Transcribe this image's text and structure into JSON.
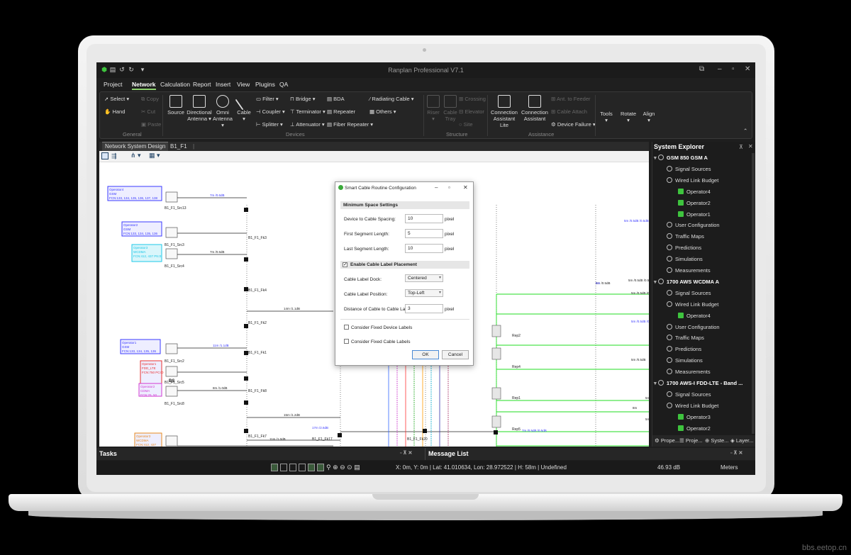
{
  "app": {
    "title": "Ranplan Professional V7.1",
    "quick_access": [
      "save-icon",
      "undo-icon",
      "redo-icon",
      "customize-icon"
    ]
  },
  "menu": [
    "Project",
    "Network",
    "Calculation",
    "Report",
    "Insert",
    "View",
    "Plugins",
    "QA"
  ],
  "menu_active": "Network",
  "ribbon": {
    "general": {
      "label": "General",
      "select": "Select",
      "hand": "Hand",
      "copy": "Copy",
      "cut": "Cut",
      "paste": "Paste"
    },
    "devices": {
      "label": "Devices",
      "source": "Source",
      "directional_1": "Directional",
      "directional_2": "Antenna",
      "omni_1": "Omni",
      "omni_2": "Antenna",
      "cable": "Cable",
      "filter": "Filter",
      "coupler": "Coupler",
      "splitter": "Splitter",
      "bridge": "Bridge",
      "terminator": "Terminator",
      "attenuator": "Attenuator",
      "bda": "BDA",
      "repeater": "Repeater",
      "fiber_repeater": "Fiber Repeater",
      "radiating_cable": "Radiating Cable",
      "others": "Others"
    },
    "structure": {
      "label": "Structure",
      "riser": "Riser",
      "cable_1": "Cable",
      "cable_2": "Tray",
      "crossing": "Crossing",
      "elevator": "Elevator",
      "site": "Site"
    },
    "assistance": {
      "label": "Assistance",
      "conn_lite_1": "Connection",
      "conn_lite_2": "Assistant Lite",
      "conn_1": "Connection",
      "conn_2": "Assistant",
      "ant_to_feeder": "Ant. to Feeder",
      "cable_attach": "Cable Attach",
      "device_failure": "Device Failure"
    },
    "tools": "Tools",
    "rotate": "Rotate",
    "align": "Align"
  },
  "doc_tabs": [
    "Network System Design",
    "B1_F1"
  ],
  "diagram": {
    "operators": [
      {
        "text": "Operator4 GSM FCN:133, 134, 135, 136, 137, 138",
        "color": "#3a3aff"
      },
      {
        "text": "Operator2 GSM FCN:133, 134, 135, 136",
        "color": "#3a3aff"
      },
      {
        "text": "Operator3 WCDMA FCN:412, 437 PN:0",
        "color": "#1ec8e8"
      },
      {
        "text": "Operator1 GSM FCN:133, 134, 135, 136",
        "color": "#3a3aff"
      },
      {
        "text": "Operator1 FDD_LTE FCN:750 PCI:0",
        "color": "#e83232"
      },
      {
        "text": "Operator2 CDMA FCN:25, 50",
        "color": "#d238d2"
      },
      {
        "text": "Operator3 WCDMA FCN:412, 437",
        "color": "#e88a1e"
      }
    ],
    "nodes": [
      "B1_F1_Src13",
      "B1_F1_Src3",
      "B1_F1_Src4",
      "B1_F1_Fk3",
      "B1_F1_Fk4",
      "B1_F1_Fk2",
      "B1_F1_Fk1",
      "B1_F1_Src2",
      "B1_F1_Src5",
      "B1_F1_Src8",
      "B1_F1_Fk8",
      "B1_F1_Fk7",
      "B1_F1_Src7",
      "B1_F1_Fk17",
      "B1_F1_Fk20",
      "Rep2",
      "Rep4",
      "Rep1",
      "Rep5"
    ],
    "cable_labels": [
      "7m /0.6dB",
      "7m /0.6dB",
      "14m /1.1dB",
      "11m /1.1dB",
      "8m /1.0dB",
      "15m /1.2dB",
      "17m /2.6dB",
      "11m /1.0dB",
      "8m /0.5dB",
      "5m /0.5dB /0.5dB /0.5dB",
      "5m /0.5dB /0.5dB",
      "5m /0.5dB /0.5dB",
      "5m /0.5dB /0.5dB",
      "5m /0.5dB",
      "8m",
      "5m",
      "5m",
      "5m",
      "7m /0.5dB /0.5dB"
    ],
    "bs": "BS"
  },
  "dialog": {
    "title": "Smart Cable Routine Configuration",
    "section1": "Minimum Space Settings",
    "fields": [
      {
        "label": "Device to Cable Spacing:",
        "value": "10",
        "unit": "pixel"
      },
      {
        "label": "First Segment Length:",
        "value": "5",
        "unit": "pixel"
      },
      {
        "label": "Last Segment Length:",
        "value": "10",
        "unit": "pixel"
      }
    ],
    "section2": "Enable Cable Label Placement",
    "dock_label": "Cable Label Dock:",
    "dock_value": "Centered",
    "position_label": "Cable Label Position:",
    "position_value": "Top-Left",
    "distance_label": "Distance of Cable to Cable Label:",
    "distance_value": "3",
    "distance_unit": "pixel",
    "fixed_device": "Consider Fixed Device Labels",
    "fixed_cable": "Consider Fixed Cable Labels",
    "ok": "OK",
    "cancel": "Cancel"
  },
  "explorer": {
    "title": "System Explorer",
    "rows": [
      {
        "text": "GSM 850 GSM A",
        "level": 0,
        "bold": true
      },
      {
        "text": "Signal Sources",
        "level": 1
      },
      {
        "text": "Wired Link Budget",
        "level": 1
      },
      {
        "text": "Operator4",
        "level": 2,
        "green": true
      },
      {
        "text": "Operator2",
        "level": 2,
        "green": true
      },
      {
        "text": "Operator1",
        "level": 2,
        "green": true
      },
      {
        "text": "User Configuration",
        "level": 1
      },
      {
        "text": "Traffic Maps",
        "level": 1
      },
      {
        "text": "Predictions",
        "level": 1
      },
      {
        "text": "Simulations",
        "level": 1
      },
      {
        "text": "Measurements",
        "level": 1
      },
      {
        "text": "1700 AWS WCDMA A",
        "level": 0,
        "bold": true
      },
      {
        "text": "Signal Sources",
        "level": 1
      },
      {
        "text": "Wired Link Budget",
        "level": 1
      },
      {
        "text": "Operator4",
        "level": 2,
        "green": true
      },
      {
        "text": "User Configuration",
        "level": 1
      },
      {
        "text": "Traffic Maps",
        "level": 1
      },
      {
        "text": "Predictions",
        "level": 1
      },
      {
        "text": "Simulations",
        "level": 1
      },
      {
        "text": "Measurements",
        "level": 1
      },
      {
        "text": "1700 AWS-I FDD-LTE - Band ...",
        "level": 0,
        "bold": true
      },
      {
        "text": "Signal Sources",
        "level": 1
      },
      {
        "text": "Wired Link Budget",
        "level": 1
      },
      {
        "text": "Operator3",
        "level": 2,
        "green": true
      },
      {
        "text": "Operator2",
        "level": 2,
        "green": true
      }
    ],
    "tabs": [
      "Prope...",
      "Proje...",
      "Syste...",
      "Layer..."
    ]
  },
  "bottom": {
    "tasks": "Tasks",
    "messages": "Message List"
  },
  "status": {
    "coords": "X: 0m, Y: 0m | Lat: 41.010634, Lon: 28.972522 | H: 58m | Undefined",
    "db": "46.93 dB",
    "units": "Meters"
  },
  "watermark": "bbs.eetop.cn",
  "colors": {
    "accent": "#8dd16d",
    "green_cable": "#22dd22",
    "screen_bg": "#1e1e1e"
  }
}
